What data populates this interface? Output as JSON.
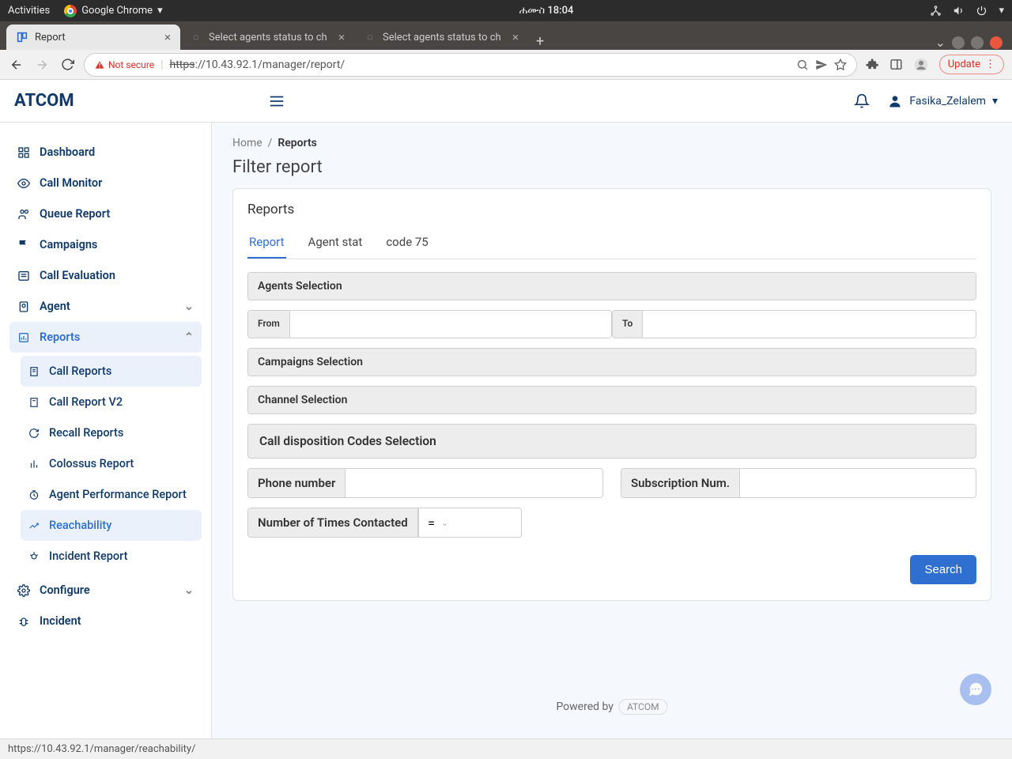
{
  "gnome": {
    "activities": "Activities",
    "app": "Google Chrome",
    "clock": "ሐሙስ  18:04"
  },
  "tabs": [
    {
      "title": "Report",
      "active": true
    },
    {
      "title": "Select agents status to ch",
      "active": false
    },
    {
      "title": "Select agents status to ch",
      "active": false
    }
  ],
  "omnibar": {
    "insecure": "Not secure",
    "url_scheme": "https",
    "url_rest": "://10.43.92.1/manager/report/",
    "update": "Update"
  },
  "header": {
    "brand": "ATCOM",
    "user": "Fasika_Zelalem"
  },
  "sidebar": {
    "items": [
      {
        "label": "Dashboard"
      },
      {
        "label": "Call Monitor"
      },
      {
        "label": "Queue Report"
      },
      {
        "label": "Campaigns"
      },
      {
        "label": "Call Evaluation"
      },
      {
        "label": "Agent"
      },
      {
        "label": "Reports"
      },
      {
        "label": "Configure"
      },
      {
        "label": "Incident"
      }
    ],
    "reports_sub": [
      {
        "label": "Call Reports"
      },
      {
        "label": "Call Report V2"
      },
      {
        "label": "Recall Reports"
      },
      {
        "label": "Colossus Report"
      },
      {
        "label": "Agent Performance Report"
      },
      {
        "label": "Reachability"
      },
      {
        "label": "Incident Report"
      }
    ]
  },
  "breadcrumb": {
    "home": "Home",
    "current": "Reports"
  },
  "page": {
    "title": "Filter report",
    "card_title": "Reports"
  },
  "content_tabs": [
    "Report",
    "Agent stat",
    "code 75"
  ],
  "filters": {
    "agents": "Agents Selection",
    "from": "From",
    "to": "To",
    "campaigns": "Campaigns Selection",
    "channel": "Channel Selection",
    "disposition": "Call disposition Codes Selection",
    "phone": "Phone number",
    "subscription": "Subscription Num.",
    "times": "Number of Times Contacted",
    "op": "=",
    "search": "Search"
  },
  "footer": {
    "powered": "Powered by",
    "chip": "ATCOM",
    "status_link": "https://10.43.92.1/manager/reachability/"
  }
}
